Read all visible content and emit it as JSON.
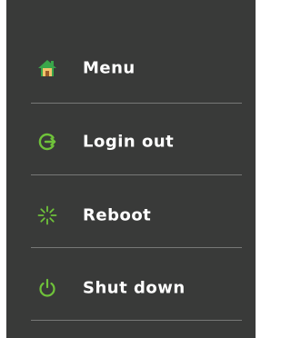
{
  "menu": {
    "items": [
      {
        "label": "Menu",
        "icon": "home-icon"
      },
      {
        "label": "Login out",
        "icon": "logout-icon"
      },
      {
        "label": "Reboot",
        "icon": "reboot-icon"
      },
      {
        "label": "Shut down",
        "icon": "power-icon"
      }
    ]
  },
  "colors": {
    "background": "#393a39",
    "text": "#ffffff",
    "divider": "#777877",
    "icon_green": "#6fc23a",
    "home_roof": "#3aa64a",
    "home_wall": "#f2c36b"
  }
}
